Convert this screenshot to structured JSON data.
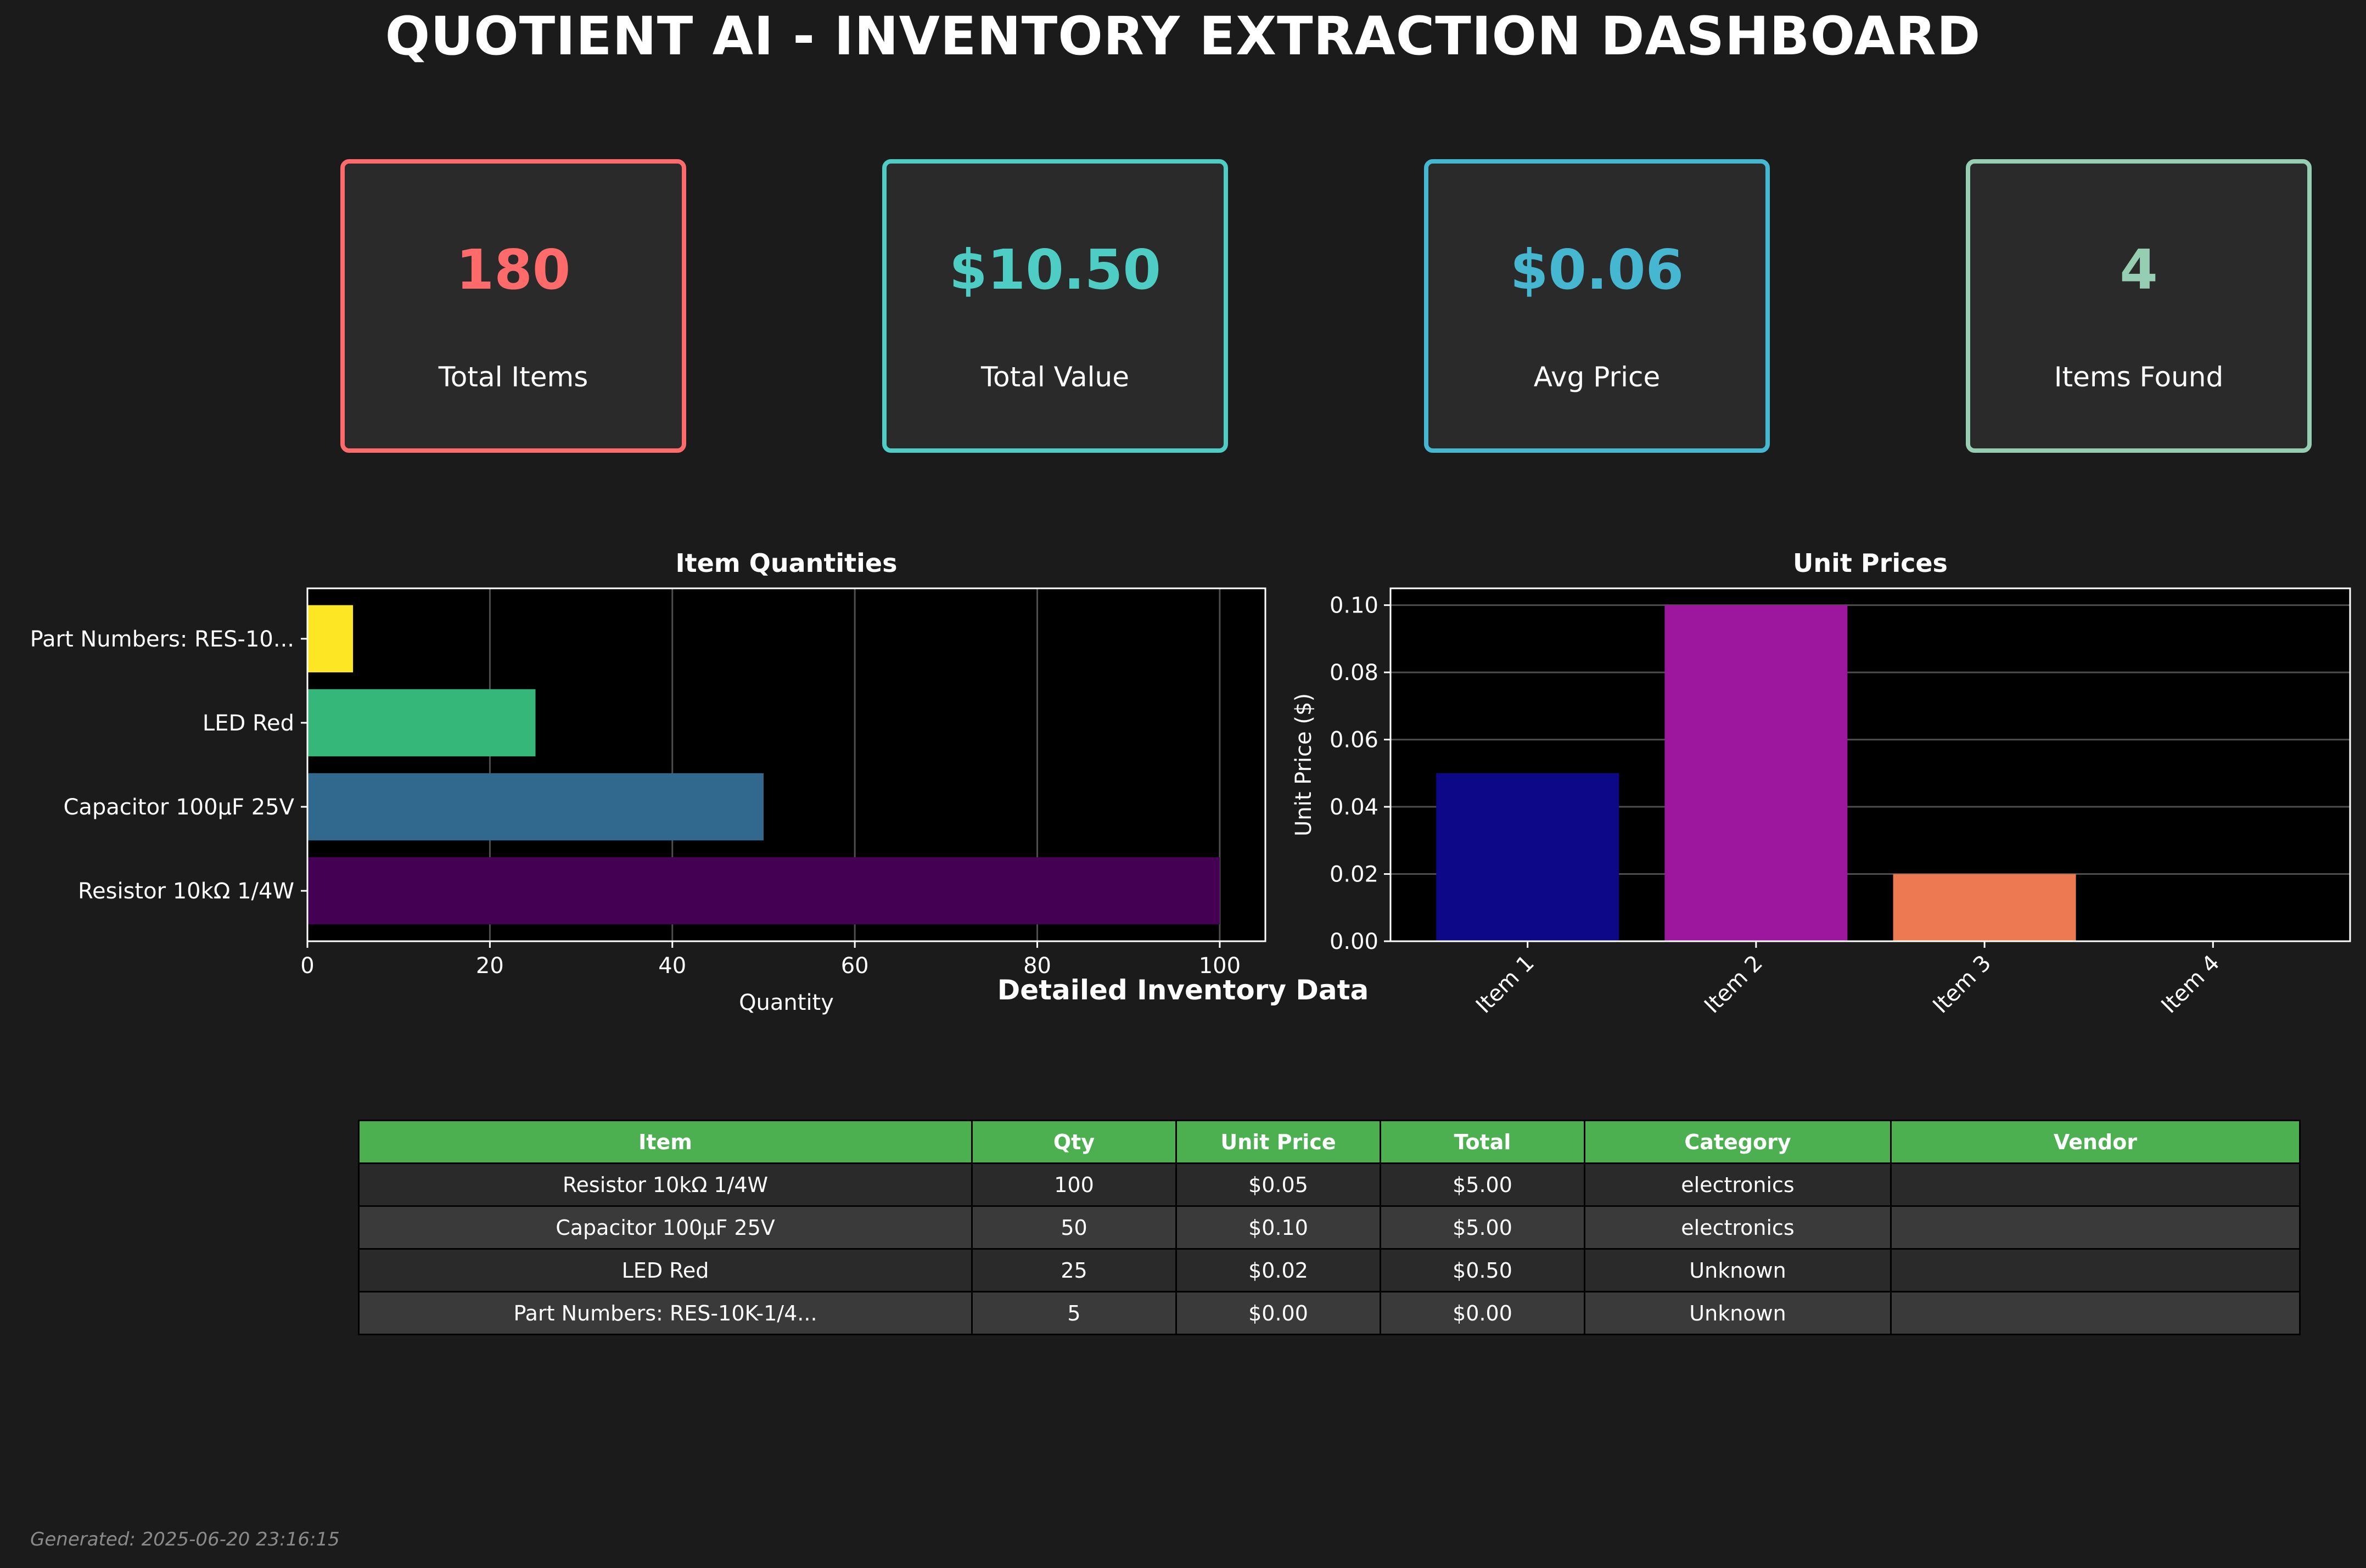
{
  "title": "QUOTIENT AI - INVENTORY EXTRACTION DASHBOARD",
  "kpis": [
    {
      "value": "180",
      "label": "Total Items",
      "color": "#ff6b6b"
    },
    {
      "value": "$10.50",
      "label": "Total Value",
      "color": "#4ecdc4"
    },
    {
      "value": "$0.06",
      "label": "Avg Price",
      "color": "#45b7d1"
    },
    {
      "value": "4",
      "label": "Items Found",
      "color": "#96ceb4"
    }
  ],
  "chart_data": [
    {
      "type": "bar",
      "orientation": "horizontal",
      "title": "Item Quantities",
      "xlabel": "Quantity",
      "ylabel": "",
      "categories": [
        "Resistor 10kΩ 1/4W",
        "Capacitor 100µF 25V",
        "LED Red",
        "Part Numbers: RES-10..."
      ],
      "values": [
        100,
        50,
        25,
        5
      ],
      "colors": [
        "#440154",
        "#31688e",
        "#35b779",
        "#fde725"
      ],
      "xlim": [
        0,
        105
      ],
      "xticks": [
        0,
        20,
        40,
        60,
        80,
        100
      ],
      "grid": true
    },
    {
      "type": "bar",
      "title": "Unit Prices",
      "xlabel": "",
      "ylabel": "Unit Price ($)",
      "categories": [
        "Item 1",
        "Item 2",
        "Item 3",
        "Item 4"
      ],
      "values": [
        0.05,
        0.1,
        0.02,
        0.0
      ],
      "colors": [
        "#0d0887",
        "#9c179e",
        "#ed7953",
        "#f0f921"
      ],
      "ylim": [
        0,
        0.105
      ],
      "yticks": [
        "0.00",
        "0.02",
        "0.04",
        "0.06",
        "0.08",
        "0.10"
      ],
      "grid": true
    }
  ],
  "table": {
    "title": "Detailed Inventory Data",
    "headers": [
      "Item",
      "Qty",
      "Unit Price",
      "Total",
      "Category",
      "Vendor"
    ],
    "rows": [
      [
        "Resistor 10kΩ 1/4W",
        "100",
        "$0.05",
        "$5.00",
        "electronics",
        ""
      ],
      [
        "Capacitor 100µF 25V",
        "50",
        "$0.10",
        "$5.00",
        "electronics",
        ""
      ],
      [
        "LED Red",
        "25",
        "$0.02",
        "$0.50",
        "Unknown",
        ""
      ],
      [
        "Part Numbers: RES-10K-1/4...",
        "5",
        "$0.00",
        "$0.00",
        "Unknown",
        ""
      ]
    ]
  },
  "footer": "Generated: 2025-06-20 23:16:15"
}
